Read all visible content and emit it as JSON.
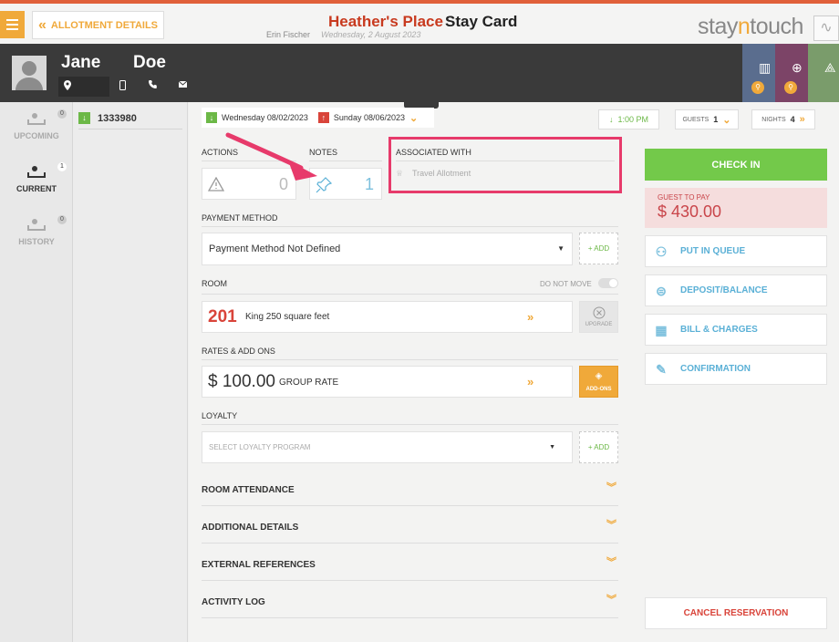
{
  "colors": {
    "accent": "#f0a93a",
    "brand_red": "#c83a1f",
    "check_in": "#73c94a",
    "link_blue": "#5ab0d6",
    "annotation": "#e73a6b",
    "danger": "#d9443a"
  },
  "header": {
    "back_label": "ALLOTMENT DETAILS",
    "hotel_name": "Heather's Place",
    "card_title": "Stay Card",
    "user_name": "Erin Fischer",
    "business_date": "Wednesday, 2 August 2023",
    "logo": {
      "pre": "stay",
      "mid": "n",
      "post": "touch"
    }
  },
  "guest": {
    "first_name": "Jane",
    "last_name": "Doe",
    "icons": [
      "location-icon",
      "phone-icon",
      "call-icon",
      "mail-icon"
    ]
  },
  "sidebar": {
    "items": [
      {
        "label": "UPCOMING",
        "count": "0",
        "icon": "bed-icon"
      },
      {
        "label": "CURRENT",
        "count": "1",
        "icon": "bed-icon"
      },
      {
        "label": "HISTORY",
        "count": "0",
        "icon": "bed-icon"
      }
    ]
  },
  "reservation_list": {
    "items": [
      {
        "number": "1333980"
      }
    ]
  },
  "stay": {
    "arrival": "Wednesday 08/02/2023",
    "departure": "Sunday 08/06/2023",
    "time": "1:00 PM",
    "guests_label": "GUESTS",
    "guests": "1",
    "nights_label": "NIGHTS",
    "nights": "4"
  },
  "actions": {
    "label": "ACTIONS",
    "count": "0"
  },
  "notes": {
    "label": "NOTES",
    "count": "1"
  },
  "associated": {
    "label": "ASSOCIATED WITH",
    "value": "Travel Allotment"
  },
  "payment": {
    "label": "PAYMENT METHOD",
    "selected": "Payment Method Not Defined",
    "add_label": "+ ADD"
  },
  "room": {
    "label": "ROOM",
    "do_not_move": "DO NOT MOVE",
    "number": "201",
    "type": "King 250 square feet",
    "upgrade_label": "UPGRADE"
  },
  "rates": {
    "label": "RATES & ADD ONS",
    "amount": "$ 100.00",
    "rate_name": "GROUP RATE",
    "addons_label": "ADD-ONS"
  },
  "loyalty": {
    "label": "LOYALTY",
    "placeholder": "SELECT LOYALTY PROGRAM",
    "add_label": "+ ADD"
  },
  "sections": [
    "ROOM ATTENDANCE",
    "ADDITIONAL DETAILS",
    "EXTERNAL REFERENCES",
    "ACTIVITY LOG"
  ],
  "right": {
    "check_in": "CHECK IN",
    "guest_to_pay_label": "GUEST TO PAY",
    "guest_to_pay": "$ 430.00",
    "buttons": [
      {
        "label": "PUT IN QUEUE",
        "icon": "queue-icon"
      },
      {
        "label": "DEPOSIT/BALANCE",
        "icon": "deposit-icon"
      },
      {
        "label": "BILL & CHARGES",
        "icon": "calculator-icon"
      },
      {
        "label": "CONFIRMATION",
        "icon": "feather-icon"
      }
    ],
    "cancel": "CANCEL RESERVATION"
  }
}
